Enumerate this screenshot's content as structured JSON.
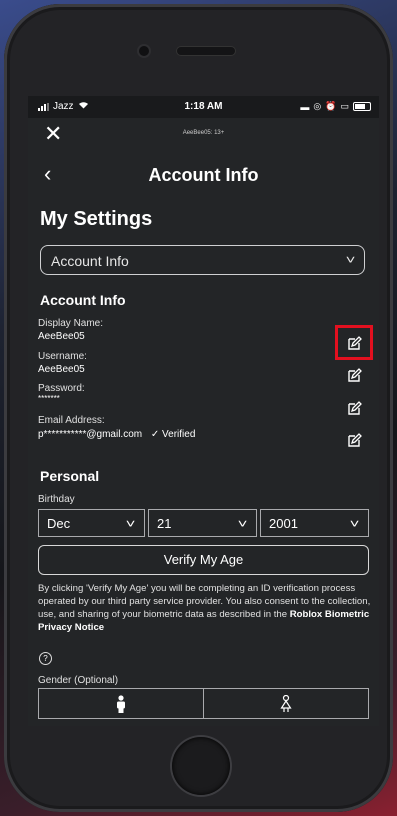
{
  "status_bar": {
    "carrier": "Jazz",
    "time": "1:18 AM"
  },
  "top_bar": {
    "username_tag": "AeeBee05: 13+"
  },
  "header": {
    "title": "Account Info"
  },
  "settings": {
    "title": "My Settings",
    "selector_value": "Account Info"
  },
  "account_info": {
    "section_title": "Account Info",
    "display_name_label": "Display Name:",
    "display_name_value": "AeeBee05",
    "username_label": "Username:",
    "username_value": "AeeBee05",
    "password_label": "Password:",
    "password_value": "*******",
    "email_label": "Email Address:",
    "email_value": "p***********@gmail.com",
    "verified_label": "Verified"
  },
  "personal": {
    "section_title": "Personal",
    "birthday_label": "Birthday",
    "month": "Dec",
    "day": "21",
    "year": "2001",
    "verify_button": "Verify My Age",
    "disclaimer": "By clicking 'Verify My Age' you will be completing an ID verification process operated by our third party service provider. You also consent to the collection, use, and sharing of your biometric data as described in the",
    "privacy_link": "Roblox Biometric Privacy Notice",
    "gender_label": "Gender (Optional)"
  },
  "colors": {
    "highlight": "#e2101f",
    "screen_bg": "#232527"
  }
}
